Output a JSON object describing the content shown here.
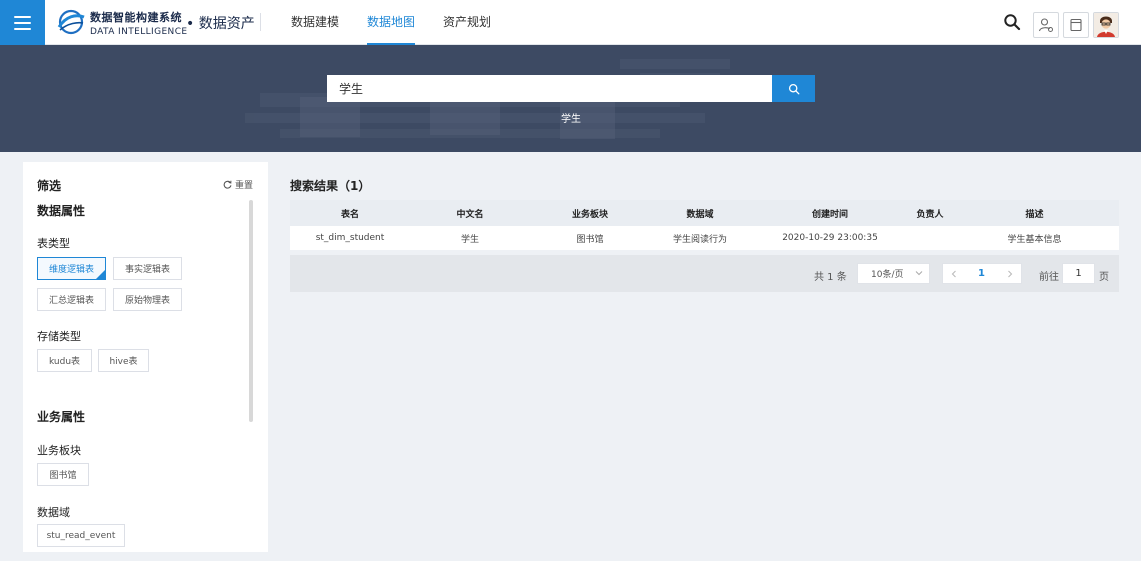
{
  "header": {
    "logo_cn": "数据智能构建系统",
    "logo_en": "DATA INTELLIGENCE",
    "subtitle": "• 数据资产",
    "nav": [
      {
        "label": "数据建模",
        "active": false
      },
      {
        "label": "数据地图",
        "active": true
      },
      {
        "label": "资产规划",
        "active": false
      }
    ],
    "icons": [
      "menu-icon",
      "search-icon",
      "user-settings-icon",
      "window-icon",
      "avatar"
    ]
  },
  "banner": {
    "search_value": "学生",
    "tag": "学生"
  },
  "filter": {
    "title": "筛选",
    "reset": "重置",
    "data_attr": {
      "title": "数据属性",
      "table_type": {
        "title": "表类型",
        "options": [
          "维度逻辑表",
          "事实逻辑表",
          "汇总逻辑表",
          "原始物理表"
        ],
        "selected": "维度逻辑表"
      },
      "storage_type": {
        "title": "存储类型",
        "options": [
          "kudu表",
          "hive表"
        ]
      }
    },
    "biz_attr": {
      "title": "业务属性",
      "biz_section": {
        "title": "业务板块",
        "options": [
          "图书馆"
        ]
      },
      "domain": {
        "title": "数据域",
        "options": [
          "stu_read_event"
        ]
      }
    }
  },
  "results": {
    "title": "搜索结果（1）",
    "columns": [
      "表名",
      "中文名",
      "业务板块",
      "数据域",
      "创建时间",
      "负责人",
      "描述"
    ],
    "rows": [
      [
        "st_dim_student",
        "学生",
        "图书馆",
        "学生阅读行为",
        "2020-10-29 23:00:35",
        "",
        "学生基本信息"
      ]
    ]
  },
  "pagination": {
    "total": "共 1 条",
    "page_size": "10条/页",
    "current": "1",
    "goto_label": "前往",
    "goto_value": "1",
    "page_label": "页"
  },
  "colors": {
    "primary": "#1f87d6",
    "banner_bg": "#3d4a63",
    "page_bg": "#eef1f5"
  }
}
